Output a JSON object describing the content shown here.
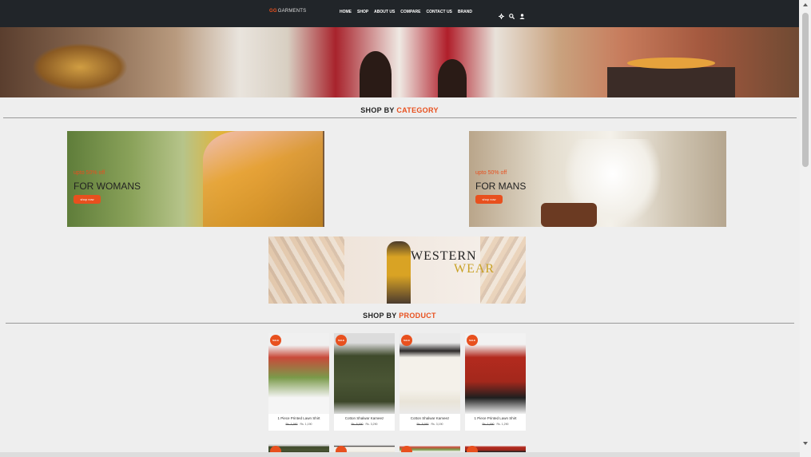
{
  "header": {
    "brand_mark": "GG",
    "brand_name": "GARMENTS",
    "nav": [
      "HOME",
      "SHOP",
      "ABOUT US",
      "COMPARE",
      "CONTACT US",
      "BRAND"
    ],
    "icons": [
      "settings-icon",
      "search-icon",
      "user-icon"
    ]
  },
  "category_section": {
    "title_prefix": "SHOP BY",
    "title_accent": "CATEGORY",
    "women": {
      "promo": "upto 50% off",
      "label": "FOR WOMANS",
      "button": "shop now"
    },
    "men": {
      "promo": "upto 50% off",
      "label": "FOR MANS",
      "button": "shop now"
    },
    "western": {
      "line1": "WESTERN",
      "line2": "WEAR"
    }
  },
  "product_section": {
    "title_prefix": "SHOP BY",
    "title_accent": "PRODUCT",
    "sale_badge": "SALE",
    "products": [
      {
        "name": "1 Piece Printed Lawn Shirt",
        "old_price": "Rs. 1,990",
        "price": "Rs. 1,190"
      },
      {
        "name": "Cotton Shalwar Kameez",
        "old_price": "Rs. 5,990",
        "price": "Rs. 3,290"
      },
      {
        "name": "Cotton Shalwar Kameez",
        "old_price": "Rs. 5,990",
        "price": "Rs. 3,190"
      },
      {
        "name": "1 Piece Printed Lawn Shirt",
        "old_price": "Rs. 1,990",
        "price": "Rs. 1,290"
      }
    ]
  },
  "colors": {
    "accent": "#e8501e",
    "topbar": "#212529",
    "background": "#eeeeee"
  }
}
